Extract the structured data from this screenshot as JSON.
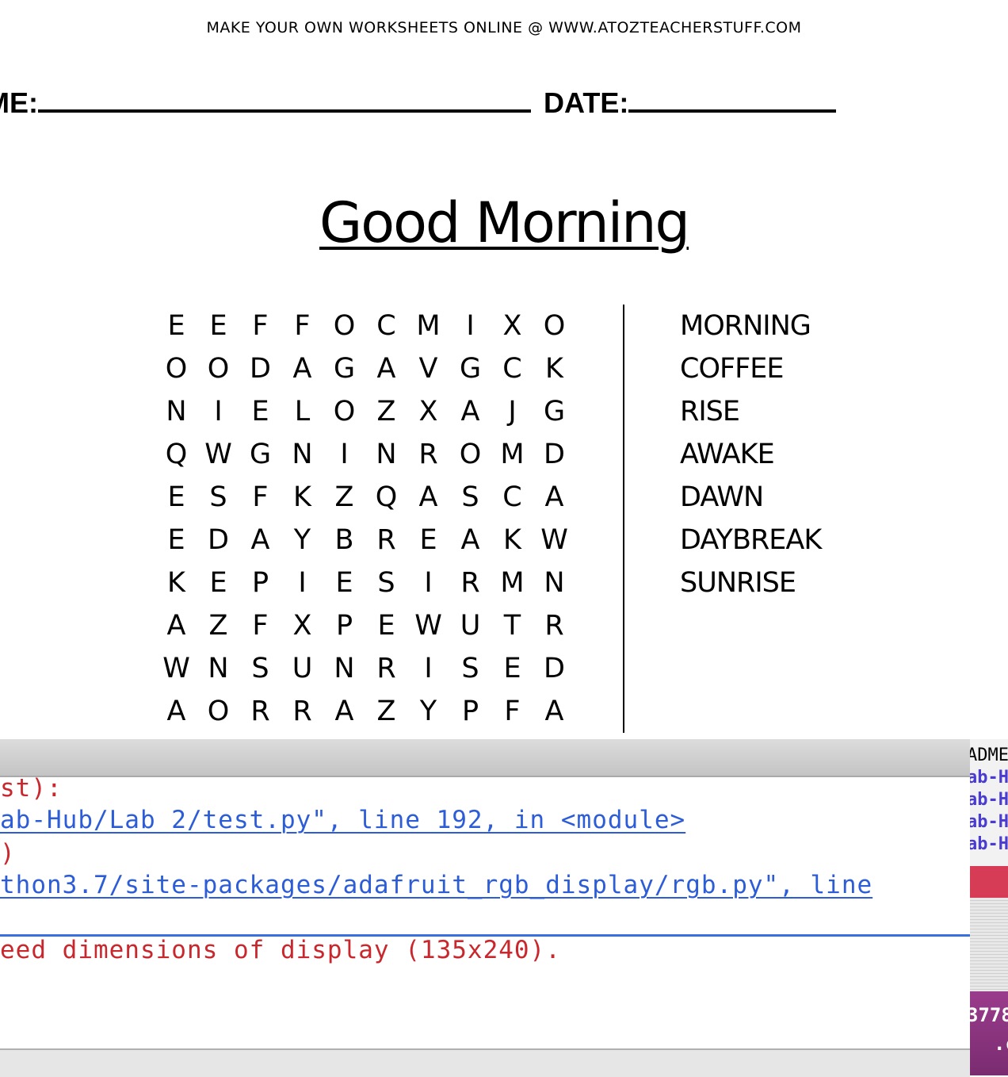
{
  "worksheet": {
    "banner": "MAKE YOUR OWN WORKSHEETS ONLINE @ WWW.ATOZTEACHERSTUFF.COM",
    "name_label": "ME:",
    "date_label": "DATE:",
    "title": "Good Morning",
    "grid": [
      [
        "E",
        "E",
        "F",
        "F",
        "O",
        "C",
        "M",
        "I",
        "X",
        "O"
      ],
      [
        "O",
        "O",
        "D",
        "A",
        "G",
        "A",
        "V",
        "G",
        "C",
        "K"
      ],
      [
        "N",
        "I",
        "E",
        "L",
        "O",
        "Z",
        "X",
        "A",
        "J",
        "G"
      ],
      [
        "Q",
        "W",
        "G",
        "N",
        "I",
        "N",
        "R",
        "O",
        "M",
        "D"
      ],
      [
        "E",
        "S",
        "F",
        "K",
        "Z",
        "Q",
        "A",
        "S",
        "C",
        "A"
      ],
      [
        "E",
        "D",
        "A",
        "Y",
        "B",
        "R",
        "E",
        "A",
        "K",
        "W"
      ],
      [
        "K",
        "E",
        "P",
        "I",
        "E",
        "S",
        "I",
        "R",
        "M",
        "N"
      ],
      [
        "A",
        "Z",
        "F",
        "X",
        "P",
        "E",
        "W",
        "U",
        "T",
        "R"
      ],
      [
        "W",
        "N",
        "S",
        "U",
        "N",
        "R",
        "I",
        "S",
        "E",
        "D"
      ],
      [
        "A",
        "O",
        "R",
        "R",
        "A",
        "Z",
        "Y",
        "P",
        "F",
        "A"
      ]
    ],
    "words": [
      "MORNING",
      "COFFEE",
      "RISE",
      "AWAKE",
      "DAWN",
      "DAYBREAK",
      "SUNRISE"
    ]
  },
  "terminal": {
    "line1": "st):",
    "line2": "ab-Hub/Lab 2/test.py\", line 192, in <module>",
    "line3": ")",
    "line4": "thon3.7/site-packages/adafruit_rgb_display/rgb.py\", line",
    "line5": "eed dimensions of display (135x240)."
  },
  "side_window": {
    "header": "ADME",
    "lines": [
      "ab-H",
      "ab-H",
      "ab-H",
      "ab-H"
    ],
    "number": "3778",
    "suffix": ".c"
  }
}
